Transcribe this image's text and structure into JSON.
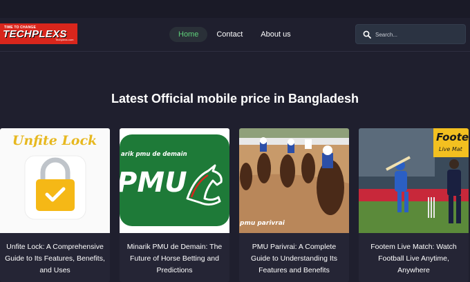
{
  "logo": {
    "tagline": "TIME TO CHANGE",
    "name": "TECHPLEXS",
    "sub": "Techplexs.com"
  },
  "nav": {
    "items": [
      {
        "label": "Home"
      },
      {
        "label": "Contact"
      },
      {
        "label": "About us"
      }
    ]
  },
  "search": {
    "placeholder": "Search..."
  },
  "headline": "Latest Official mobile price in Bangladesh",
  "cards": [
    {
      "image_text": "Unfite Lock",
      "title": "Unfite Lock: A Comprehensive Guide to Its Features, Benefits, and Uses"
    },
    {
      "image_text": "arik pmu de demain",
      "image_logo": "PMU",
      "title": "Minarik PMU de Demain: The Future of Horse Betting and Predictions"
    },
    {
      "image_text": "pmu parivrai",
      "title": "PMU Parivrai: A Complete Guide to Understanding Its Features and Benefits"
    },
    {
      "image_text": "Foote",
      "image_sub": "Live Mat",
      "title": "Footem Live Match: Watch Football Live Anytime, Anywhere"
    }
  ]
}
